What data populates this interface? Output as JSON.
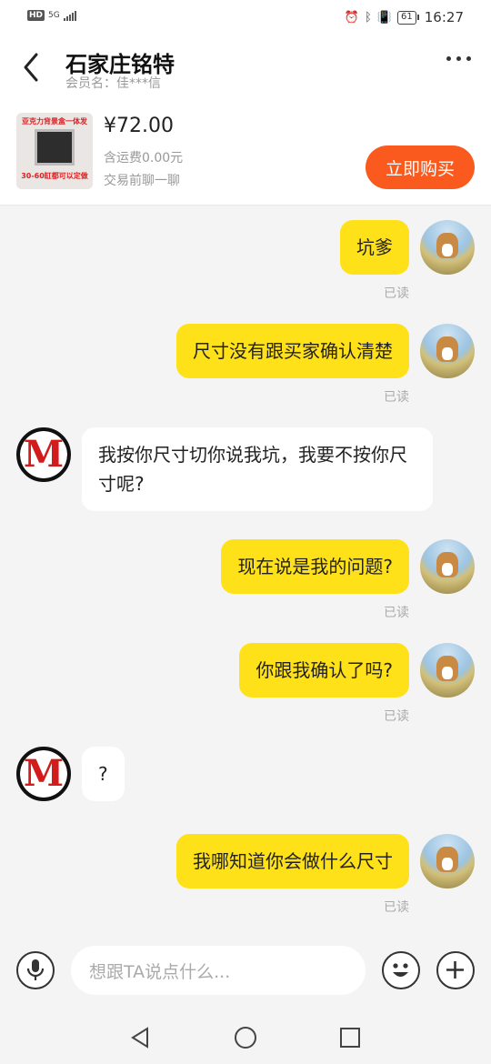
{
  "status_bar": {
    "hd": "HD",
    "network": "5G",
    "time": "16:27",
    "battery": "61"
  },
  "header": {
    "title": "石家庄铭特",
    "subtitle": "会员名：佳***信"
  },
  "product": {
    "image_text_top": "亚克力背景盒一体发",
    "image_text_bottom": "30-60缸都可以定做",
    "price": "¥72.00",
    "shipping": "含运费0.00元",
    "hint": "交易前聊一聊",
    "buy_label": "立即购买"
  },
  "messages": [
    {
      "from": "me",
      "text": "坑爹",
      "status": "已读"
    },
    {
      "from": "me",
      "text": "尺寸没有跟买家确认清楚",
      "status": "已读"
    },
    {
      "from": "them",
      "text": "我按你尺寸切你说我坑，我要不按你尺寸呢?"
    },
    {
      "from": "me",
      "text": "现在说是我的问题?",
      "status": "已读"
    },
    {
      "from": "me",
      "text": "你跟我确认了吗?",
      "status": "已读"
    },
    {
      "from": "them",
      "text": "?"
    },
    {
      "from": "me",
      "text": "我哪知道你会做什么尺寸",
      "status": "已读"
    }
  ],
  "input": {
    "placeholder": "想跟TA说点什么..."
  },
  "icons": {
    "back": "chevron-left-icon",
    "more": "more-dots-icon",
    "mic": "microphone-icon",
    "emoji": "emoji-icon",
    "plus": "plus-icon"
  },
  "colors": {
    "my_bubble": "#ffe11a",
    "buy_button": "#fb5a1f",
    "their_avatar_letter": "#d21c1c"
  }
}
